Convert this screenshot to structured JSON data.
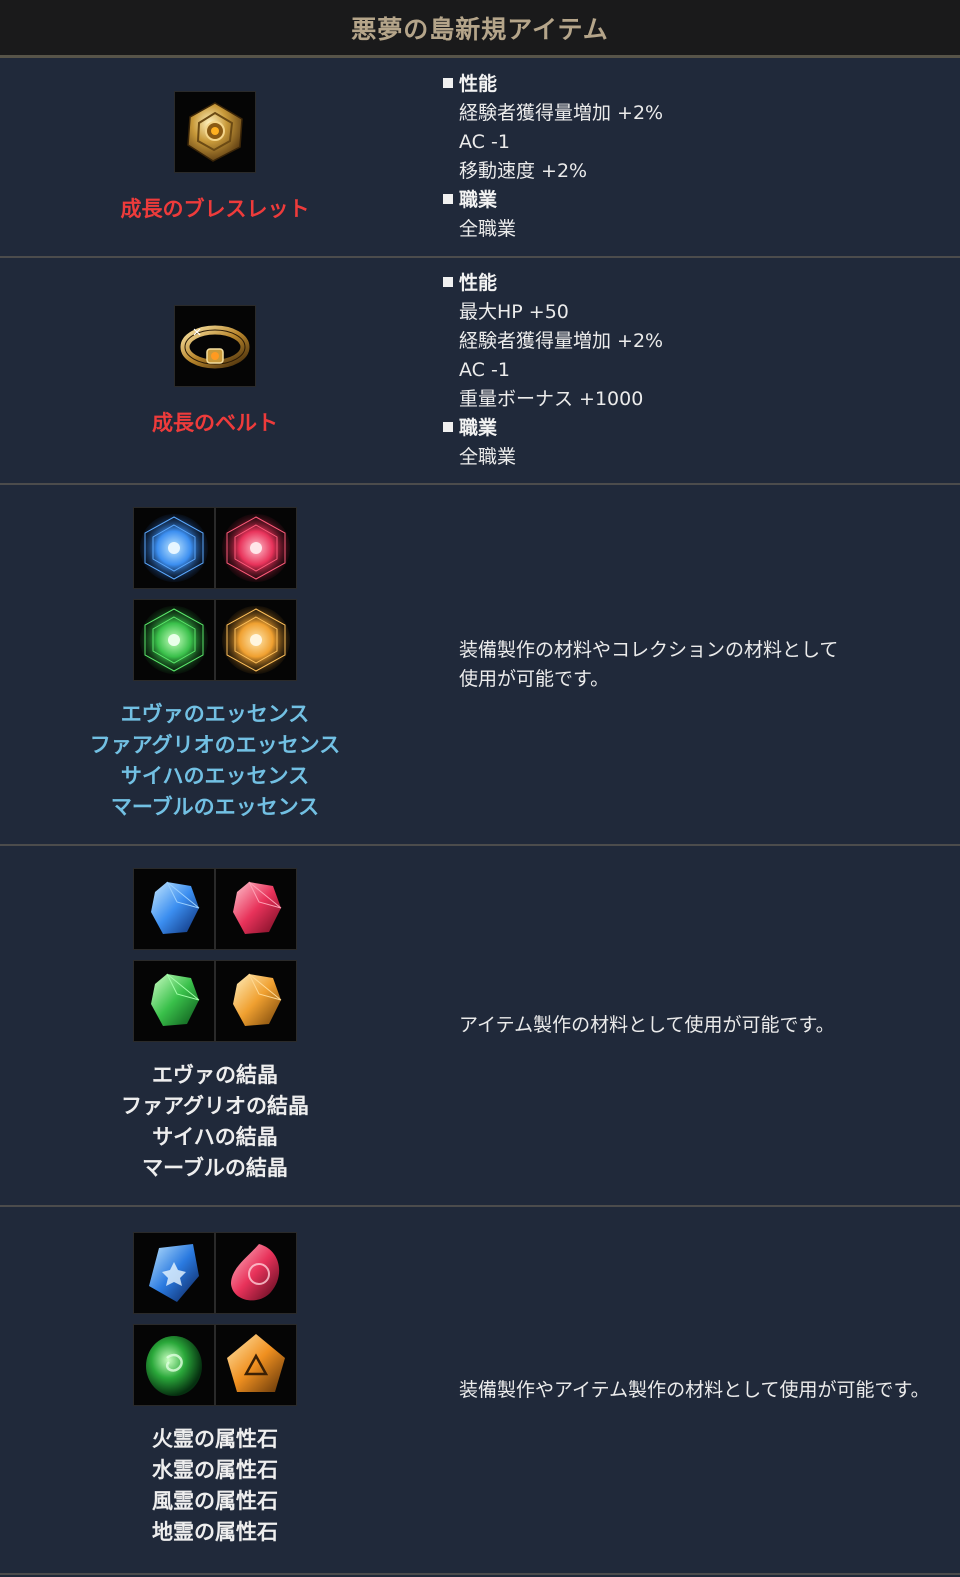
{
  "title": "悪夢の島新規アイテム",
  "items": [
    {
      "name": "成長のブレスレット",
      "icon": "bracelet-icon",
      "sections": [
        {
          "head": "性能",
          "lines": [
            "経験者獲得量増加 +2%",
            "AC -1",
            "移動速度 +2%"
          ]
        },
        {
          "head": "職業",
          "lines": [
            "全職業"
          ]
        }
      ]
    },
    {
      "name": "成長のベルト",
      "icon": "belt-icon",
      "sections": [
        {
          "head": "性能",
          "lines": [
            "最大HP +50",
            "経験者獲得量増加 +2%",
            "AC -1",
            "重量ボーナス +1000"
          ]
        },
        {
          "head": "職業",
          "lines": [
            "全職業"
          ]
        }
      ]
    },
    {
      "names": [
        "エヴァのエッセンス",
        "ファアグリオのエッセンス",
        "サイハのエッセンス",
        "マーブルのエッセンス"
      ],
      "icons": [
        "blue-essence-icon",
        "red-essence-icon",
        "green-essence-icon",
        "orange-essence-icon"
      ],
      "desc": [
        "装備製作の材料やコレクションの材料として",
        "使用が可能です。"
      ]
    },
    {
      "names": [
        "エヴァの結晶",
        "ファアグリオの結晶",
        "サイハの結晶",
        "マーブルの結晶"
      ],
      "icons": [
        "blue-crystal-icon",
        "red-crystal-icon",
        "green-crystal-icon",
        "orange-crystal-icon"
      ],
      "desc": [
        "アイテム製作の材料として使用が可能です。"
      ]
    },
    {
      "names": [
        "火霊の属性石",
        "水霊の属性石",
        "風霊の属性石",
        "地霊の属性石"
      ],
      "icons": [
        "blue-attribute-stone-icon",
        "red-attribute-stone-icon",
        "green-attribute-stone-icon",
        "orange-attribute-stone-icon"
      ],
      "desc": [
        "装備製作やアイテム製作の材料として使用が可能です。"
      ]
    }
  ],
  "colors": {
    "background": "#20293a",
    "header_bg": "#1a1a1b",
    "header_text": "#b5a58a",
    "name_red": "#ee3b3b",
    "name_blue": "#72c0e3",
    "blue": "#3b8ef0",
    "red": "#e8325a",
    "green": "#39c04a",
    "orange": "#f0a030"
  }
}
